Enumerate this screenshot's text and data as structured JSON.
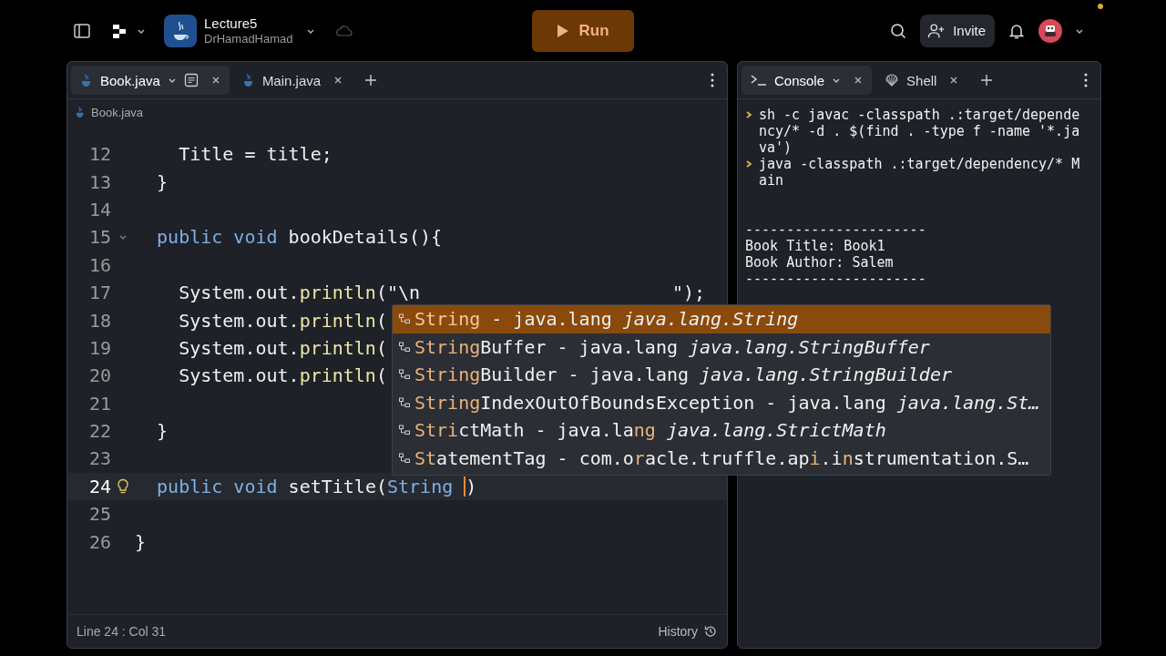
{
  "topbar": {
    "project": {
      "name": "Lecture5",
      "owner": "DrHamadHamad"
    },
    "run_button": "Run",
    "invite_button": "Invite"
  },
  "editor": {
    "tabs": [
      {
        "label": "Book.java",
        "selected": true
      },
      {
        "label": "Main.java",
        "selected": false
      }
    ],
    "breadcrumb": "Book.java",
    "lines": [
      {
        "number": "12",
        "active": false,
        "tokens": [
          {
            "kind": "plain",
            "text": "    Title = title;"
          }
        ]
      },
      {
        "number": "13",
        "active": false,
        "tokens": [
          {
            "kind": "plain",
            "text": "  }"
          }
        ]
      },
      {
        "number": "14",
        "active": false
      },
      {
        "number": "15",
        "active": false,
        "fold": true,
        "tokens": [
          {
            "kind": "keyword",
            "text": "  public void"
          },
          {
            "kind": "plain",
            "text": " bookDetails(){"
          }
        ]
      },
      {
        "number": "16",
        "active": false
      },
      {
        "number": "17",
        "active": false,
        "tokens": [
          {
            "kind": "plain",
            "text": "    System.out."
          },
          {
            "kind": "method",
            "text": "println"
          },
          {
            "kind": "plain",
            "text": "(\"\\n"
          },
          {
            "kind": "tail",
            "text": "\");"
          }
        ]
      },
      {
        "number": "18",
        "active": false,
        "tokens": [
          {
            "kind": "plain",
            "text": "    System.out."
          },
          {
            "kind": "method",
            "text": "println"
          },
          {
            "kind": "plain",
            "text": "("
          }
        ]
      },
      {
        "number": "19",
        "active": false,
        "tokens": [
          {
            "kind": "plain",
            "text": "    System.out."
          },
          {
            "kind": "method",
            "text": "println"
          },
          {
            "kind": "plain",
            "text": "("
          }
        ]
      },
      {
        "number": "20",
        "active": false,
        "tokens": [
          {
            "kind": "plain",
            "text": "    System.out."
          },
          {
            "kind": "method",
            "text": "println"
          },
          {
            "kind": "plain",
            "text": "("
          }
        ]
      },
      {
        "number": "21",
        "active": false
      },
      {
        "number": "22",
        "active": false,
        "tokens": [
          {
            "kind": "plain",
            "text": "  }"
          }
        ]
      },
      {
        "number": "23",
        "active": false
      },
      {
        "number": "24",
        "active": true,
        "hint": true,
        "tokens": [
          {
            "kind": "keyword",
            "text": "  public void"
          },
          {
            "kind": "plain",
            "text": " setTitle("
          },
          {
            "kind": "type",
            "text": "String "
          },
          {
            "kind": "cursor"
          },
          {
            "kind": "plain",
            "text": ")"
          }
        ]
      },
      {
        "number": "25",
        "active": false
      },
      {
        "number": "26",
        "active": false,
        "tokens": [
          {
            "kind": "plain",
            "text": "}"
          }
        ]
      }
    ],
    "autocomplete": [
      {
        "selected": true,
        "parts": [
          {
            "text": "String",
            "match": true
          },
          {
            "text": " - java.lang",
            "match": false
          }
        ],
        "qualified": "java.lang.String"
      },
      {
        "selected": false,
        "parts": [
          {
            "text": "String",
            "match": true
          },
          {
            "text": "Buffer - java.lang",
            "match": false
          }
        ],
        "qualified": "java.lang.StringBuffer"
      },
      {
        "selected": false,
        "parts": [
          {
            "text": "String",
            "match": true
          },
          {
            "text": "Builder - java.lang",
            "match": false
          }
        ],
        "qualified": "java.lang.StringBuilder"
      },
      {
        "selected": false,
        "parts": [
          {
            "text": "String",
            "match": true
          },
          {
            "text": "IndexOutOfBoundsException - java.lang",
            "match": false
          }
        ],
        "qualified": "java.lang.St…"
      },
      {
        "selected": false,
        "parts": [
          {
            "text": "Stri",
            "match": true
          },
          {
            "text": "ctMath - java.la",
            "match": false
          },
          {
            "text": "ng",
            "match": true
          }
        ],
        "qualified": "java.lang.StrictMath"
      },
      {
        "selected": false,
        "parts": [
          {
            "text": "St",
            "match": true
          },
          {
            "text": "atementTag - com.o",
            "match": false
          },
          {
            "text": "r",
            "match": true
          },
          {
            "text": "acle.truffle.ap",
            "match": false
          },
          {
            "text": "i",
            "match": true
          },
          {
            "text": ".i",
            "match": false
          },
          {
            "text": "n",
            "match": true
          },
          {
            "text": "strumentation.S…",
            "match": false
          }
        ]
      }
    ],
    "status": {
      "position": "Line 24 : Col 31",
      "history": "History"
    }
  },
  "console": {
    "tabs": [
      {
        "label": "Console",
        "kind": "console",
        "selected": true
      },
      {
        "label": "Shell",
        "kind": "shell",
        "selected": false
      }
    ],
    "lines": [
      {
        "kind": "command",
        "text": "sh -c javac -classpath .:target/dependency/* -d . $(find . -type f -name '*.java')"
      },
      {
        "kind": "command",
        "text": "java -classpath .:target/dependency/* Main"
      },
      {
        "kind": "blank"
      },
      {
        "kind": "output",
        "text": "----------------------"
      },
      {
        "kind": "output",
        "text": "Book Title: Book1"
      },
      {
        "kind": "output",
        "text": "Book Author: Salem"
      },
      {
        "kind": "output",
        "text": "----------------------"
      }
    ]
  }
}
